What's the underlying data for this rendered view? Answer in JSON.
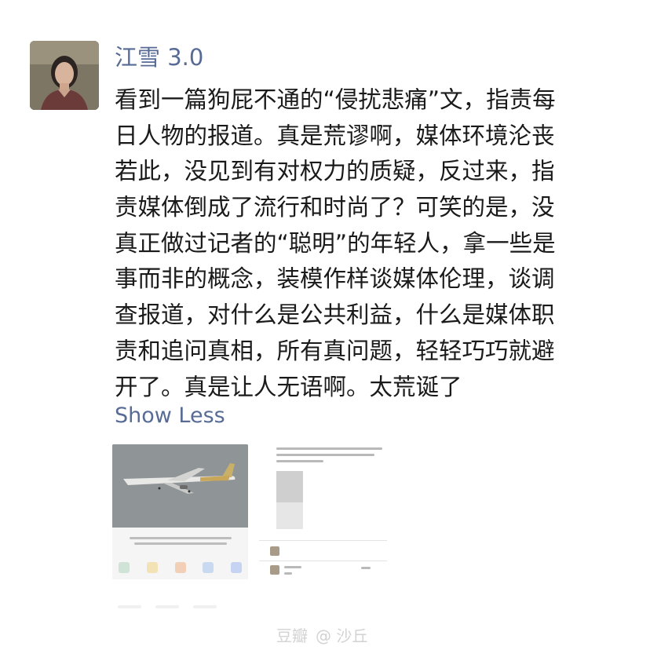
{
  "post": {
    "author": "江雪 3.0",
    "body_lines": [
      "看到一篇狗屁不通的“侵扰悲痛”文，指责每",
      "日人物的报道。真是荒谬啊，媒体环境沦丧",
      "若此，没见到有对权力的质疑，反过来，指",
      "责媒体倒成了流行和时尚了？可笑的是，没",
      "真正做过记者的“聪明”的年轻人，拿一些是",
      "事而非的概念，装模作样谈媒体伦理，谈调",
      "查报道，对什么是公共利益，什么是媒体职",
      "责和追问真相，所有真问题，轻轻巧巧就避",
      "开了。真是让人无语啊。太荒诞了"
    ],
    "show_less": "Show Less"
  },
  "watermark": {
    "site": "豆瓣",
    "user": "@ 沙丘"
  },
  "colors": {
    "link": "#576b95",
    "text": "#1a1a1a"
  }
}
